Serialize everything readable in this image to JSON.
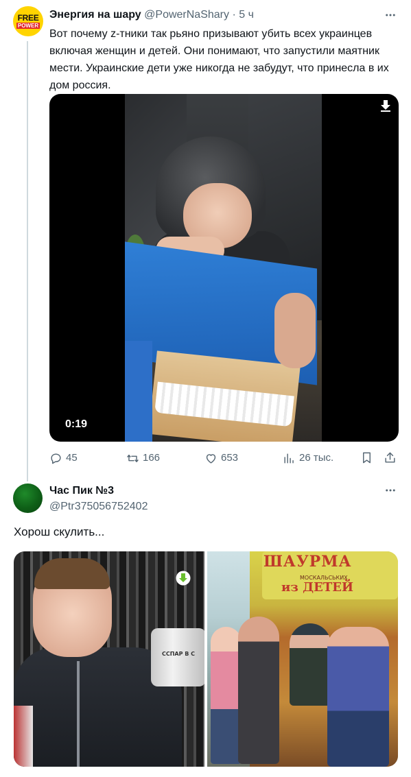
{
  "tweet1": {
    "author_name": "Энергия на шару",
    "author_handle": "@PowerNaShary",
    "separator": " · ",
    "time": "5 ч",
    "avatar_text_top": "FREE",
    "avatar_text_bottom": "POWER",
    "text": "Вот почему z-тники так рьяно призывают убить всех украинцев включая женщин и детей. Они понимают, что запустили маятник мести. Украинские дети уже никогда не забудут, что принесла в их дом россия.",
    "video": {
      "duration": "0:19"
    },
    "actions": {
      "replies": "45",
      "retweets": "166",
      "likes": "653",
      "views": "26 тыс."
    }
  },
  "tweet2": {
    "author_name": "Час Пик №3",
    "author_handle": "@Ptr375056752402",
    "text": "Хорош скулить...",
    "photo_left": {
      "can_label": "ССПАР В С"
    },
    "photo_right": {
      "sign_top": "ШАУРМА",
      "sign_small": "МОСКАЛЬСЬКИХ",
      "sign_bottom": "из ДЕТЕЙ"
    }
  },
  "colors": {
    "text_primary": "#0f1419",
    "text_secondary": "#536471",
    "thread_line": "#cfd9de",
    "avatar1_bg": "#ffd400",
    "avatar2_bg": "#0e5f17",
    "download_badge": "#6abf2e"
  },
  "icons": {
    "more": "more-horizontal-icon",
    "reply": "reply-icon",
    "retweet": "retweet-icon",
    "like": "heart-icon",
    "views": "bar-chart-icon",
    "bookmark": "bookmark-icon",
    "share": "share-icon",
    "download": "download-icon"
  }
}
